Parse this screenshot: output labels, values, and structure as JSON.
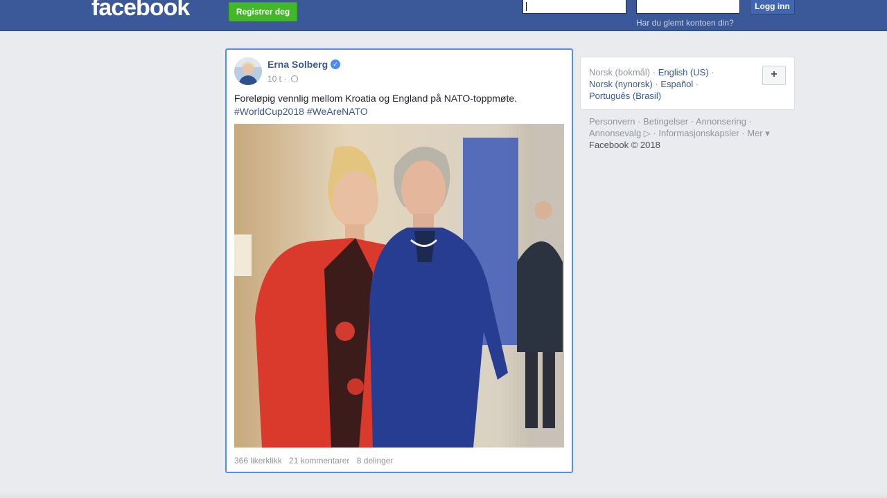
{
  "header": {
    "logo": "facebook",
    "register_label": "Registrer deg",
    "login_label": "Logg inn",
    "forgot_label": "Har du glemt kontoen din?"
  },
  "post": {
    "author": "Erna Solberg",
    "time": "10 t ·",
    "text": "Foreløpig vennlig mellom Kroatia og England på NATO-toppmøte.",
    "hashtags": [
      "#WorldCup2018",
      "#WeAreNATO"
    ],
    "stats": {
      "likes": "366 likerklikk",
      "comments": "21 kommentarer",
      "shares": "8 delinger"
    }
  },
  "languages": {
    "current": "Norsk (bokmål)",
    "links": [
      "English (US)",
      "Norsk (nynorsk)",
      "Español",
      "Português (Brasil)"
    ],
    "more_button": "+"
  },
  "footer": {
    "links": [
      "Personvern",
      "Betingelser",
      "Annonsering",
      "Annonsevalg",
      "Informasjonskapsler",
      "Mer"
    ],
    "copyright": "Facebook © 2018"
  },
  "colors": {
    "topbar": "#3b5998",
    "register_green": "#42b72a",
    "link_blue": "#365899",
    "focus_border": "#4b8ff0"
  }
}
